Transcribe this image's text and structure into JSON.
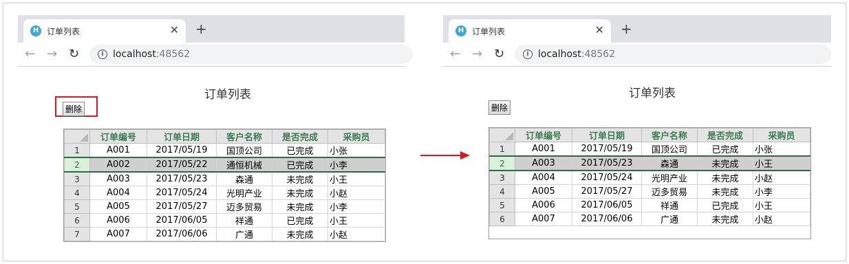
{
  "browser": {
    "tab_title": "订单列表",
    "tab_icon": "H",
    "close_glyph": "✕",
    "newtab_glyph": "+",
    "back_glyph": "←",
    "forward_glyph": "→",
    "reload_glyph": "↻",
    "url_host": "localhost",
    "url_port": ":48562"
  },
  "page": {
    "title": "订单列表",
    "delete_label": "删除"
  },
  "grid": {
    "headers": [
      "订单编号",
      "订单日期",
      "客户名称",
      "是否完成",
      "采购员"
    ]
  },
  "before": {
    "selected_row": 2,
    "rows": [
      {
        "n": "1",
        "id": "A001",
        "date": "2017/05/19",
        "customer": "国顶公司",
        "done": "已完成",
        "buyer": "小张"
      },
      {
        "n": "2",
        "id": "A002",
        "date": "2017/05/22",
        "customer": "通恒机械",
        "done": "已完成",
        "buyer": "小李"
      },
      {
        "n": "3",
        "id": "A003",
        "date": "2017/05/23",
        "customer": "森通",
        "done": "未完成",
        "buyer": "小王"
      },
      {
        "n": "4",
        "id": "A004",
        "date": "2017/05/24",
        "customer": "光明产业",
        "done": "未完成",
        "buyer": "小赵"
      },
      {
        "n": "5",
        "id": "A005",
        "date": "2017/05/27",
        "customer": "迈多贸易",
        "done": "未完成",
        "buyer": "小李"
      },
      {
        "n": "6",
        "id": "A006",
        "date": "2017/06/05",
        "customer": "祥通",
        "done": "已完成",
        "buyer": "小王"
      },
      {
        "n": "7",
        "id": "A007",
        "date": "2017/06/06",
        "customer": "广通",
        "done": "未完成",
        "buyer": "小赵"
      }
    ]
  },
  "after": {
    "selected_row": 2,
    "rows": [
      {
        "n": "1",
        "id": "A001",
        "date": "2017/05/19",
        "customer": "国顶公司",
        "done": "已完成",
        "buyer": "小张"
      },
      {
        "n": "2",
        "id": "A003",
        "date": "2017/05/23",
        "customer": "森通",
        "done": "未完成",
        "buyer": "小王"
      },
      {
        "n": "3",
        "id": "A004",
        "date": "2017/05/24",
        "customer": "光明产业",
        "done": "未完成",
        "buyer": "小赵"
      },
      {
        "n": "4",
        "id": "A005",
        "date": "2017/05/27",
        "customer": "迈多贸易",
        "done": "未完成",
        "buyer": "小李"
      },
      {
        "n": "5",
        "id": "A006",
        "date": "2017/06/05",
        "customer": "祥通",
        "done": "已完成",
        "buyer": "小王"
      },
      {
        "n": "6",
        "id": "A007",
        "date": "2017/06/06",
        "customer": "广通",
        "done": "未完成",
        "buyer": "小赵"
      }
    ]
  },
  "colors": {
    "header_text": "#3e7b52",
    "selection_border": "#2e6b42",
    "highlight_box": "#e0141b",
    "arrow": "#e0141b"
  }
}
